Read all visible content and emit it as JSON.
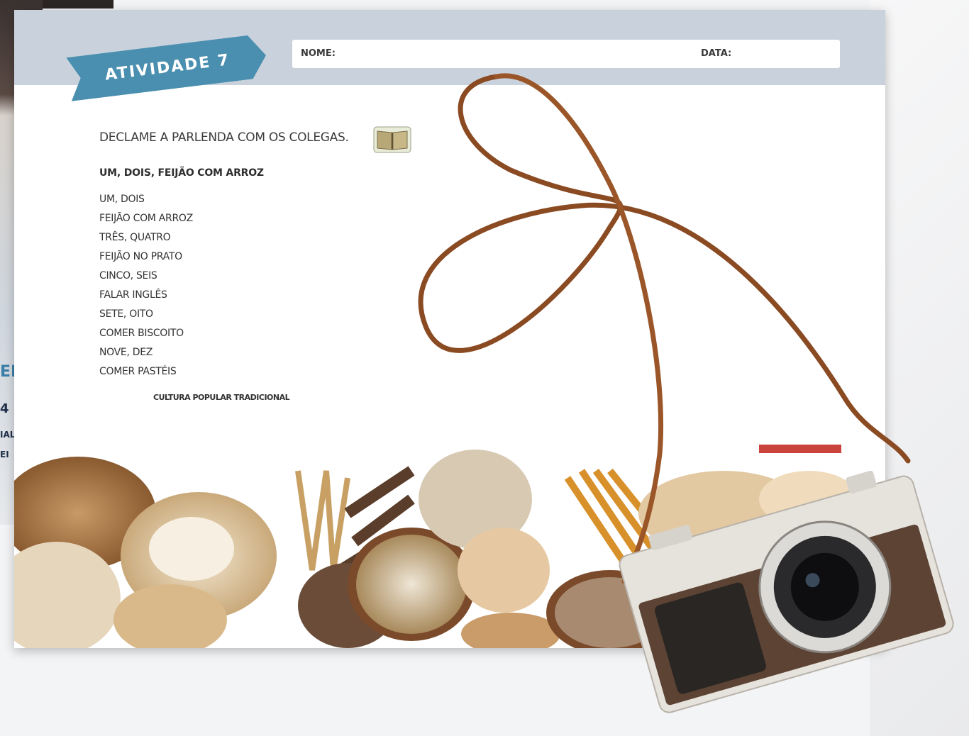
{
  "activity": {
    "title": "ATIVIDADE 7",
    "name_label": "NOME:",
    "date_label": "DATA:",
    "instruction": "DECLAME A PARLENDA COM OS COLEGAS.",
    "poem_title": "UM, DOIS, FEIJÃO COM ARROZ",
    "poem_lines": [
      "UM, DOIS",
      "FEIJÃO COM ARROZ",
      "TRÊS, QUATRO",
      "FEIJÃO NO PRATO",
      "CINCO, SEIS",
      "FALAR INGLÊS",
      "SETE, OITO",
      "COMER BISCOITO",
      "NOVE, DEZ",
      "COMER PASTÉIS"
    ],
    "source": "CULTURA POPULAR TRADICIONAL"
  },
  "background_book": {
    "fragments": [
      "EN",
      "4",
      "IAL",
      "EI"
    ]
  },
  "colors": {
    "ribbon": "#4a8fb0",
    "header_band": "#c9d2dc",
    "strap": "#8a4a22"
  },
  "icons": [
    "book-icon",
    "camera-icon"
  ]
}
